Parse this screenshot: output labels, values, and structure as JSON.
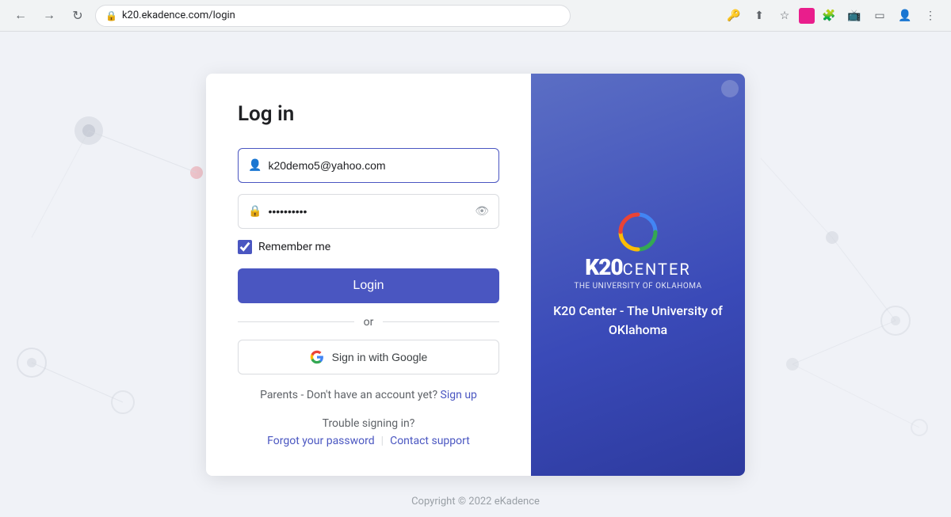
{
  "browser": {
    "url": "k20.ekadence.com/login",
    "back_title": "Back",
    "forward_title": "Forward",
    "reload_title": "Reload"
  },
  "page": {
    "title": "Log in",
    "email_value": "k20demo5@yahoo.com",
    "email_placeholder": "Email",
    "password_placeholder": "Password",
    "password_value": "••••••••••",
    "remember_label": "Remember me",
    "login_btn": "Login",
    "divider": "or",
    "google_btn": "Sign in with Google",
    "parents_text": "Parents - Don't have an account yet?",
    "signup_link": "Sign up",
    "trouble_title": "Trouble signing in?",
    "forgot_link": "Forgot your password",
    "support_link": "Contact support"
  },
  "right_panel": {
    "brand_k20": "K20",
    "brand_center": "CENTER",
    "brand_subtitle": "THE UNIVERSITY OF OKLAHOMA",
    "org_line1": "K20 Center - The University of",
    "org_line2": "OKlahoma"
  },
  "footer": {
    "copyright": "Copyright © 2022 eKadence"
  }
}
